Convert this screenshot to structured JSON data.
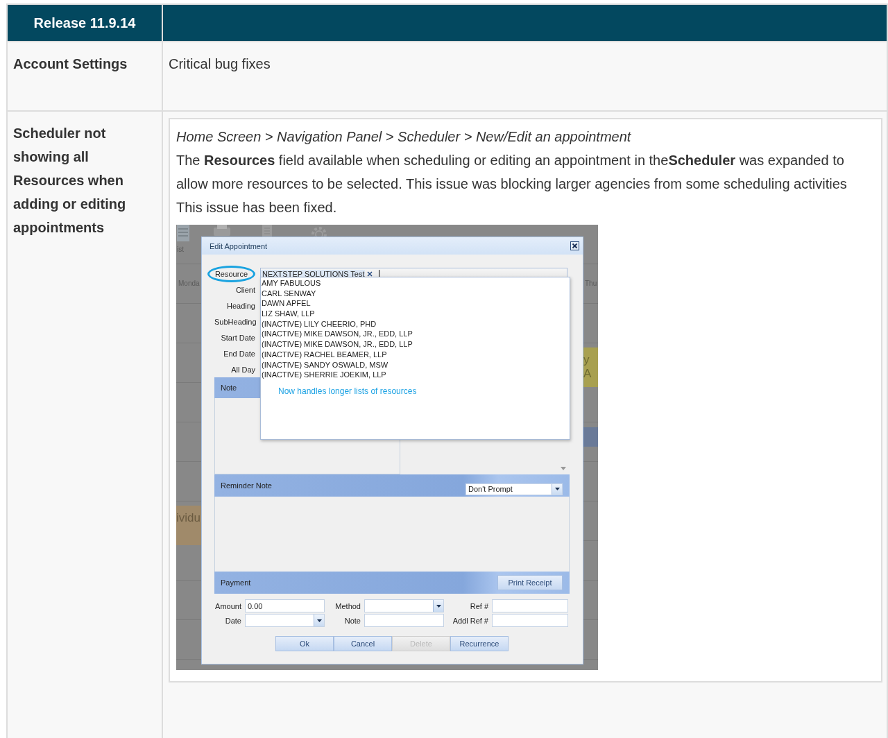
{
  "header": {
    "release": "Release 11.9.14"
  },
  "settings_row": {
    "label": "Account Settings",
    "text": "Critical bug fixes"
  },
  "fix_row": {
    "label": "Scheduler not showing all Resources when adding or editing appointments",
    "path": "Home Screen > Navigation Panel > Scheduler > New/Edit an appointment",
    "description": "The **Resources** field available when scheduling or editing an appointment in the**Scheduler** was expanded to allow more resources to be selected. This issue was blocking larger agencies from some scheduling activities",
    "status": "This issue has been fixed.",
    "screenshot": {
      "background": {
        "toolbar_label": "ist",
        "day_left": "Monda",
        "day_right": "Thu",
        "event_left": "ividu",
        "event_right": "y A"
      },
      "dialog": {
        "title": "Edit Appointment",
        "resource": {
          "label": "Resource",
          "annotated": true,
          "tag": "NEXTSTEP SOLUTIONS Test"
        },
        "labels": [
          "Client",
          "Heading",
          "SubHeading",
          "Start Date",
          "End Date",
          "All Day"
        ],
        "options": [
          "AMY FABULOUS",
          "CARL SENWAY",
          "DAWN APFEL",
          "LIZ SHAW, LLP",
          "(INACTIVE) LILY CHEERIO, PHD",
          "(INACTIVE) MIKE DAWSON, JR., EDD, LLP",
          "(INACTIVE) MIKE DAWSON, JR., EDD, LLP",
          "(INACTIVE) RACHEL BEAMER, LLP",
          "(INACTIVE) SANDY OSWALD, MSW",
          "(INACTIVE) SHERRIE JOEKIM, LLP"
        ],
        "callout": "Now handles longer lists of resources",
        "note_label": "Note",
        "reminder": {
          "label": "Reminder Note",
          "select": "Don't Prompt"
        },
        "payment": {
          "label": "Payment",
          "button": "Print Receipt",
          "fields": [
            {
              "label": "Amount",
              "kind": "text",
              "value": "0.00"
            },
            {
              "label": "Method",
              "kind": "select"
            },
            {
              "label": "Ref #",
              "kind": "text"
            },
            {
              "label": "Date",
              "kind": "select"
            },
            {
              "label": "Note",
              "kind": "text"
            },
            {
              "label": "Addl Ref #",
              "kind": "text"
            }
          ]
        },
        "buttons": [
          {
            "label": "Ok",
            "disabled": false
          },
          {
            "label": "Cancel",
            "disabled": false
          },
          {
            "label": "Delete",
            "disabled": true
          },
          {
            "label": "Recurrence",
            "disabled": false
          }
        ]
      }
    }
  }
}
